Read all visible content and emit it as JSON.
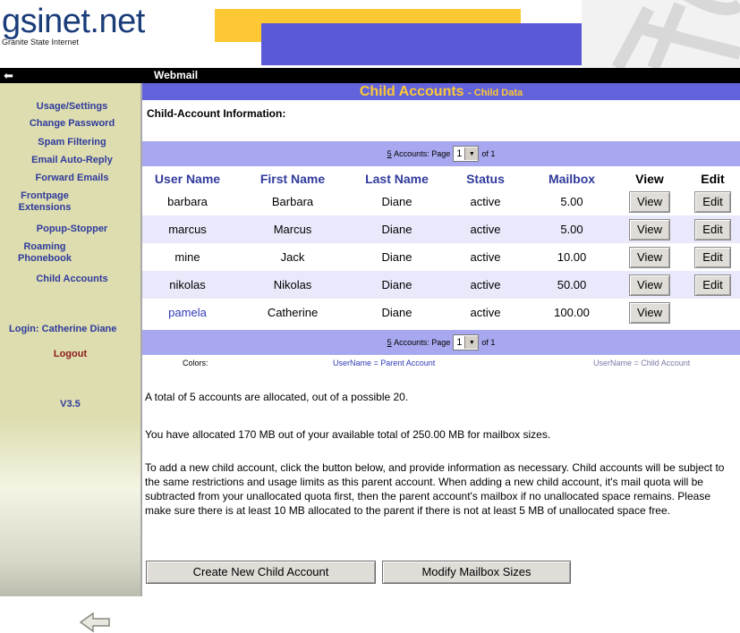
{
  "header": {
    "logo_main": "gsinet.net",
    "logo_sub": "Granite State Internet",
    "bar_colors": {
      "yellow": "#fdc833",
      "purple": "#5a5ad8"
    }
  },
  "topbar": {
    "back_icon": "left-arrow-icon",
    "title": "Webmail"
  },
  "sidebar": {
    "items": [
      {
        "label": "Usage/Settings"
      },
      {
        "label": "Change Password"
      },
      {
        "label": "Spam Filtering"
      },
      {
        "label": "Email Auto-Reply"
      },
      {
        "label": "Forward Emails"
      },
      {
        "label": "Frontpage Extensions"
      },
      {
        "label": "Popup-Stopper"
      },
      {
        "label": "Roaming Phonebook"
      },
      {
        "label": "Child Accounts"
      }
    ],
    "login": "Login: Catherine Diane",
    "logout": "Logout",
    "version": "V3.5"
  },
  "main": {
    "title": "Child Accounts",
    "subtitle": "- Child Data",
    "info_heading": "Child-Account Information:",
    "pager": {
      "count": "5",
      "accounts_label": "Accounts: Page",
      "page": "1",
      "of_label": "of 1"
    },
    "columns": [
      "User Name",
      "First Name",
      "Last Name",
      "Status",
      "Mailbox",
      "View",
      "Edit"
    ],
    "rows": [
      {
        "username": "barbara",
        "first": "Barbara",
        "last": "Diane",
        "status": "active",
        "mailbox": "5.00",
        "view": "View",
        "edit": "Edit"
      },
      {
        "username": "marcus",
        "first": "Marcus",
        "last": "Diane",
        "status": "active",
        "mailbox": "5.00",
        "view": "View",
        "edit": "Edit"
      },
      {
        "username": "mine",
        "first": "Jack",
        "last": "Diane",
        "status": "active",
        "mailbox": "10.00",
        "view": "View",
        "edit": "Edit"
      },
      {
        "username": "nikolas",
        "first": "Nikolas",
        "last": "Diane",
        "status": "active",
        "mailbox": "50.00",
        "view": "View",
        "edit": "Edit"
      },
      {
        "username": "pamela",
        "first": "Catherine",
        "last": "Diane",
        "status": "active",
        "mailbox": "100.00",
        "view": "View"
      }
    ],
    "legend": {
      "colors_label": "Colors:",
      "parent": "UserName = Parent Account",
      "child": "UserName = Child Account"
    },
    "para_allocated": "A total of 5 accounts are allocated, out of a possible 20.",
    "para_mb": "You have allocated 170 MB out of your available total of 250.00 MB for mailbox sizes.",
    "para_info": "To add a new child account, click the button below, and provide information as necessary. Child accounts will be subject to the same restrictions and usage limits as this parent account. When adding a new child account, it's mail quota will be subtracted from your unallocated quota first, then the parent account's mailbox if no unallocated space remains. Please make sure there is at least 10 MB allocated to the parent if there is not at least 5 MB of unallocated space free.",
    "btn_create": "Create New Child Account",
    "btn_modify": "Modify Mailbox Sizes"
  }
}
